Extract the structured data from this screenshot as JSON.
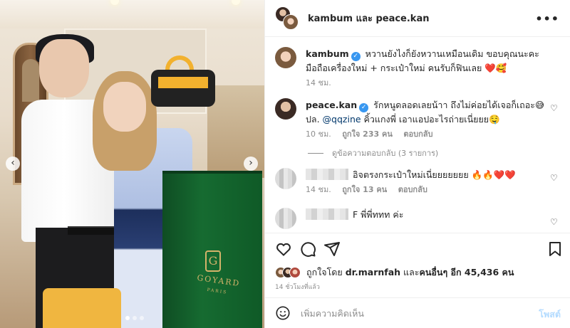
{
  "post": {
    "header_title": "kambum และ peace.kan",
    "more_icon": "more-horizontal-icon",
    "media": {
      "bag_brand": "GOYARD",
      "bag_sub": "PARIS",
      "carousel_prev": "‹",
      "carousel_next": "›",
      "dot_count": 3
    }
  },
  "comments": [
    {
      "username": "kambum",
      "verified": true,
      "text": "หวานยังไงก็ยังหวานเหมือนเดิม ขอบคุณนะคะ มือถือเครื่องใหม่ + กระเป๋าใหม่ คนรับก็ฟินเลย ❤️🥰",
      "time": "14 ชม."
    },
    {
      "username": "peace.kan",
      "verified": true,
      "text_before": "รักหนูดลอดเลยน้าา ถึงไม่ค่อยได้เจอก็เถอะ😅 ปล. ",
      "mention": "@qqzine",
      "text_after": " คิ้วแกงพี่ เอาแอปอะไรถ่ายเนี่ยยย🤤",
      "time": "10 ชม.",
      "likes": "ถูกใจ 233 คน",
      "reply": "ตอบกลับ",
      "view_replies": "ดูข้อความตอบกลับ (3 รายการ)"
    },
    {
      "username": "",
      "text": "อิจตรงกระเป๋าใหม่เนี่ยยยยยยย 🔥🔥❤️❤️",
      "time": "14 ชม.",
      "likes": "ถูกใจ 13 คน",
      "reply": "ตอบกลับ"
    },
    {
      "username": "",
      "text": "F พี่พี่ททท ค่ะ"
    }
  ],
  "actions": {
    "like_icon": "heart-icon",
    "comment_icon": "comment-icon",
    "share_icon": "paper-plane-icon",
    "save_icon": "bookmark-icon"
  },
  "likes_summary": {
    "prefix": "ถูกใจโดย ",
    "user": "dr.marnfah",
    "middle": " และ",
    "others": "คนอื่นๆ อีก 45,436 คน"
  },
  "posted_time": "14 ชั่วโมงที่แล้ว",
  "composer": {
    "placeholder": "เพิ่มความคิดเห็น",
    "post_label": "โพสต์",
    "emoji_icon": "smiley-icon"
  }
}
